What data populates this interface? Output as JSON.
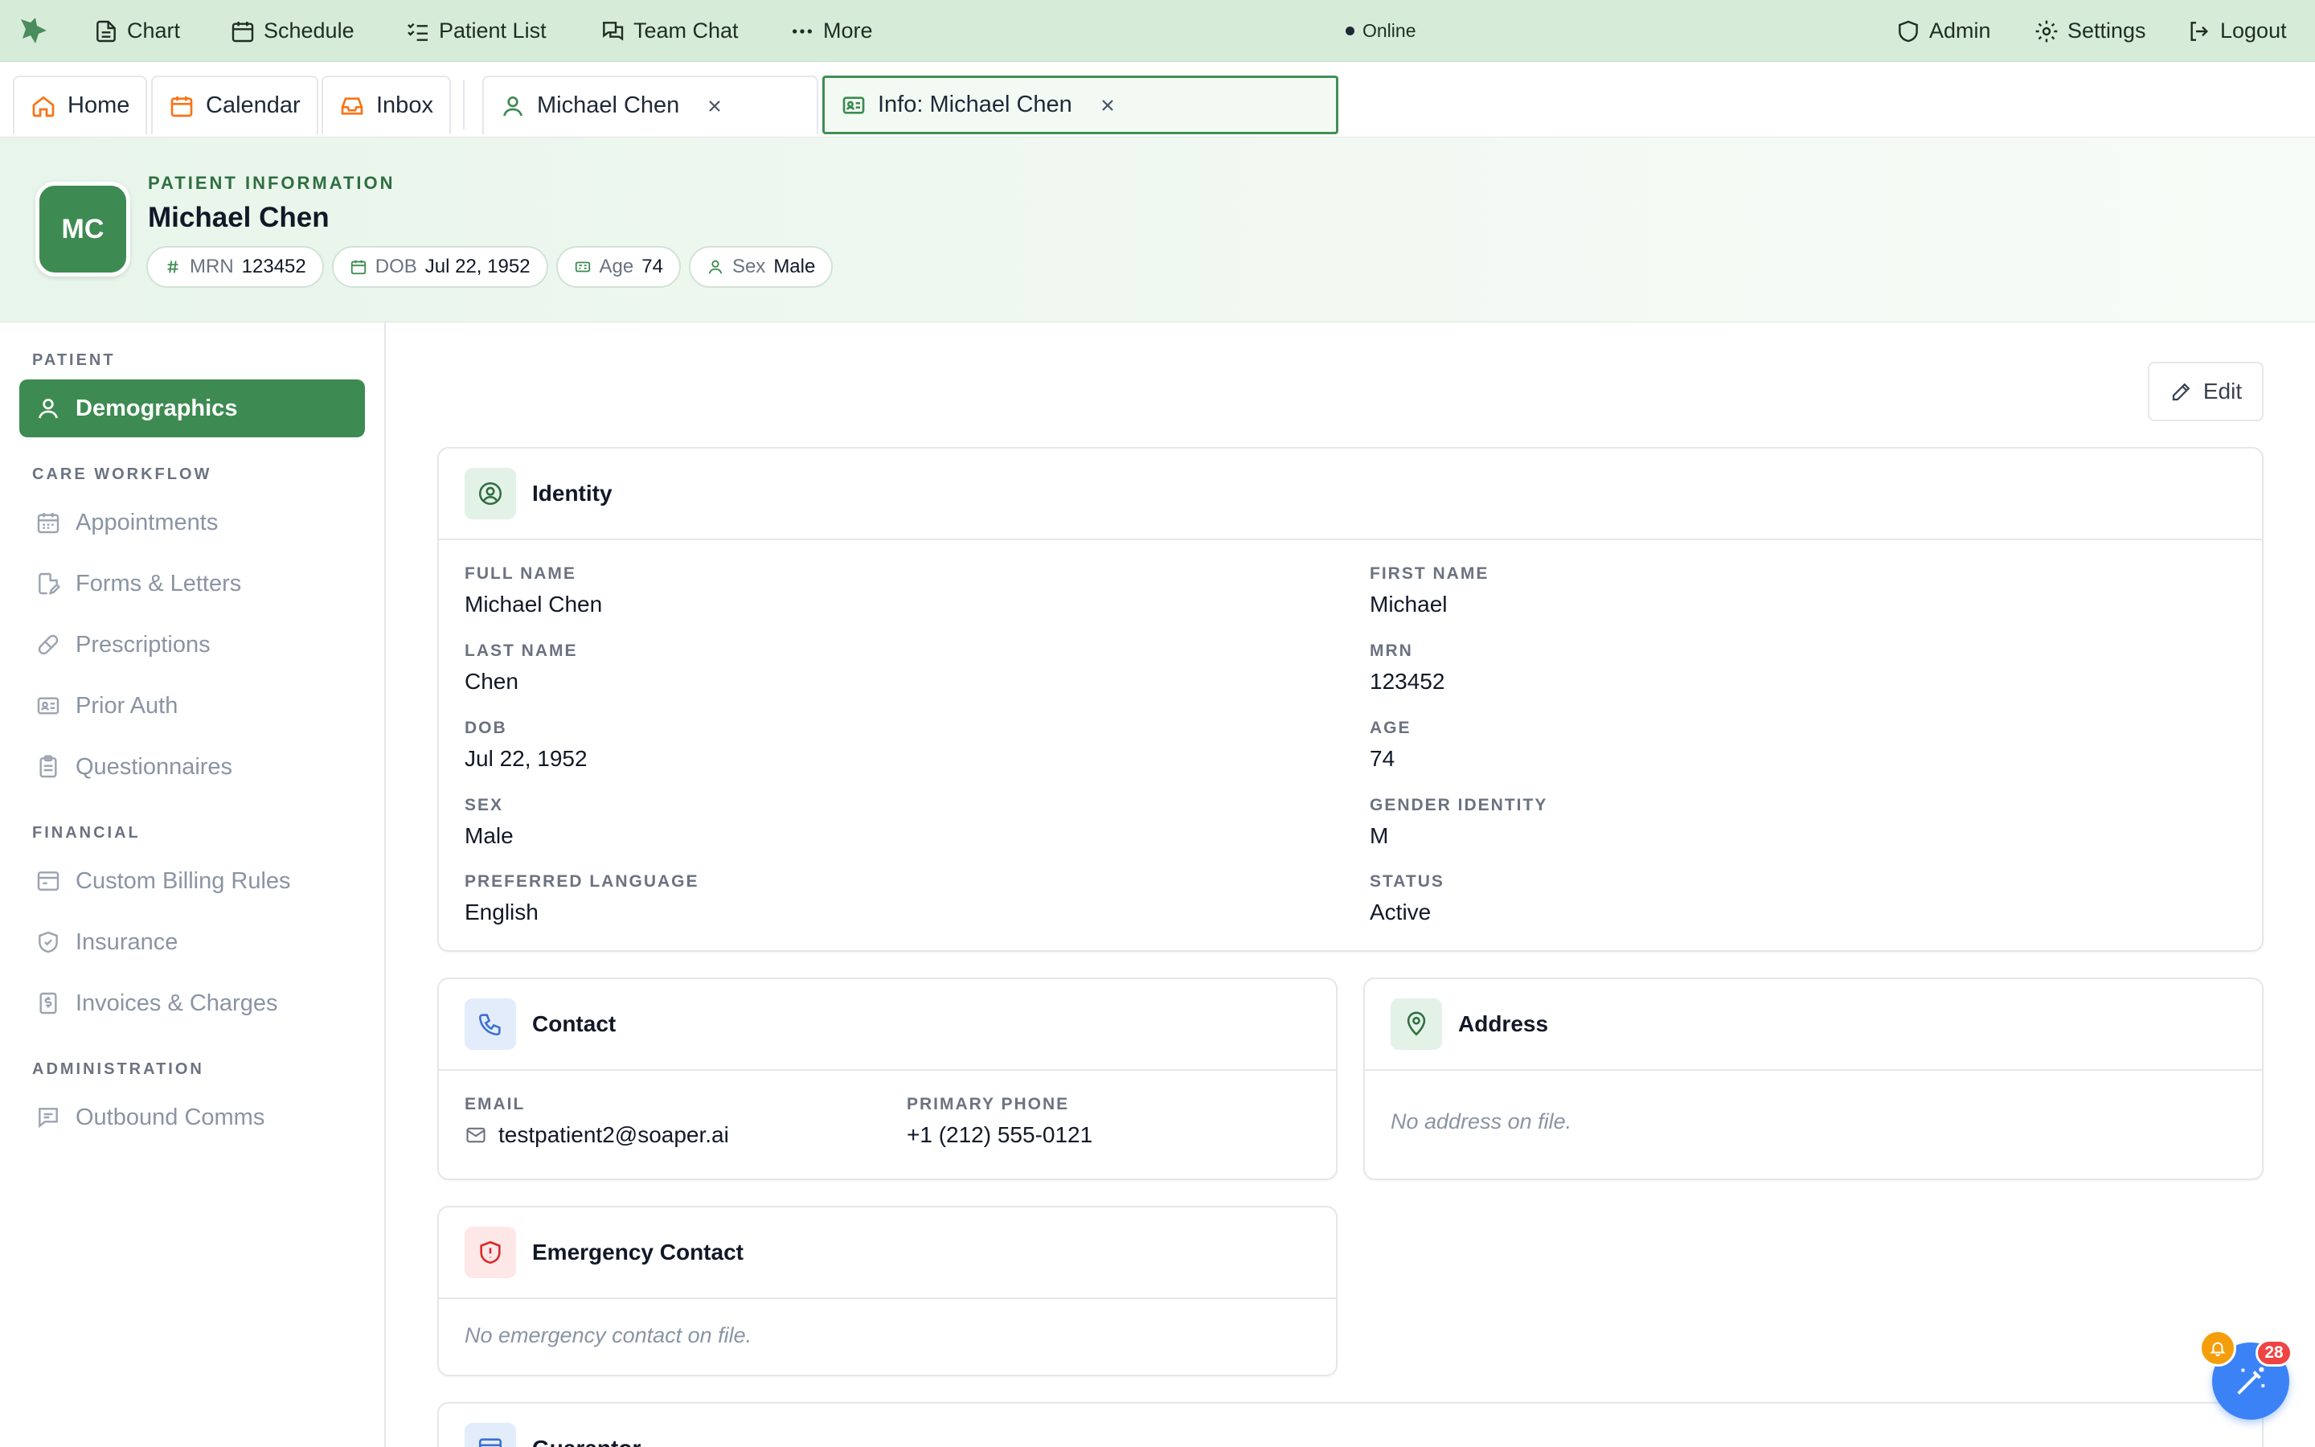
{
  "nav": {
    "items": [
      {
        "label": "Chart",
        "icon": "file-text-icon"
      },
      {
        "label": "Schedule",
        "icon": "calendar-icon"
      },
      {
        "label": "Patient List",
        "icon": "list-checks-icon"
      },
      {
        "label": "Team Chat",
        "icon": "chat-icon"
      },
      {
        "label": "More",
        "icon": "more-dots-icon"
      }
    ],
    "status": "Online",
    "right": [
      {
        "label": "Admin",
        "icon": "shield-icon"
      },
      {
        "label": "Settings",
        "icon": "gear-icon"
      },
      {
        "label": "Logout",
        "icon": "logout-icon"
      }
    ]
  },
  "tabs": {
    "pinned": [
      {
        "label": "Home",
        "icon": "home-icon"
      },
      {
        "label": "Calendar",
        "icon": "calendar-icon"
      },
      {
        "label": "Inbox",
        "icon": "inbox-icon"
      }
    ],
    "open": [
      {
        "label": "Michael Chen",
        "icon": "user-icon",
        "active": false
      },
      {
        "label": "Info: Michael Chen",
        "icon": "id-card-icon",
        "active": true
      }
    ]
  },
  "patient": {
    "eyebrow": "PATIENT INFORMATION",
    "initials": "MC",
    "name": "Michael Chen",
    "chips": [
      {
        "key": "MRN",
        "value": "123452",
        "icon": "hash-icon"
      },
      {
        "key": "DOB",
        "value": "Jul 22, 1952",
        "icon": "calendar-icon"
      },
      {
        "key": "Age",
        "value": "74",
        "icon": "id-card-icon"
      },
      {
        "key": "Sex",
        "value": "Male",
        "icon": "user-icon"
      }
    ]
  },
  "sidebar": {
    "sections": [
      {
        "title": "PATIENT",
        "items": [
          {
            "label": "Demographics",
            "icon": "user-icon",
            "active": true
          }
        ]
      },
      {
        "title": "CARE WORKFLOW",
        "items": [
          {
            "label": "Appointments",
            "icon": "calendar-icon"
          },
          {
            "label": "Forms & Letters",
            "icon": "file-edit-icon"
          },
          {
            "label": "Prescriptions",
            "icon": "pill-icon"
          },
          {
            "label": "Prior Auth",
            "icon": "id-card-icon"
          },
          {
            "label": "Questionnaires",
            "icon": "clipboard-icon"
          }
        ]
      },
      {
        "title": "FINANCIAL",
        "items": [
          {
            "label": "Custom Billing Rules",
            "icon": "wallet-icon"
          },
          {
            "label": "Insurance",
            "icon": "shield-check-icon"
          },
          {
            "label": "Invoices & Charges",
            "icon": "dollar-file-icon"
          }
        ]
      },
      {
        "title": "ADMINISTRATION",
        "items": [
          {
            "label": "Outbound Comms",
            "icon": "message-square-icon"
          }
        ]
      }
    ]
  },
  "main": {
    "edit_label": "Edit",
    "identity": {
      "title": "Identity",
      "fields": [
        {
          "label": "FULL NAME",
          "value": "Michael Chen"
        },
        {
          "label": "FIRST NAME",
          "value": "Michael"
        },
        {
          "label": "LAST NAME",
          "value": "Chen"
        },
        {
          "label": "MRN",
          "value": "123452"
        },
        {
          "label": "DOB",
          "value": "Jul 22, 1952"
        },
        {
          "label": "AGE",
          "value": "74"
        },
        {
          "label": "SEX",
          "value": "Male"
        },
        {
          "label": "GENDER IDENTITY",
          "value": "M"
        },
        {
          "label": "PREFERRED LANGUAGE",
          "value": "English"
        },
        {
          "label": "STATUS",
          "value": "Active"
        }
      ]
    },
    "contact": {
      "title": "Contact",
      "email_label": "EMAIL",
      "email": "testpatient2@soaper.ai",
      "phone_label": "PRIMARY PHONE",
      "phone": "+1 (212) 555-0121"
    },
    "address": {
      "title": "Address",
      "empty": "No address on file."
    },
    "emergency": {
      "title": "Emergency Contact",
      "empty": "No emergency contact on file."
    },
    "guarantor": {
      "title": "Guarantor"
    }
  },
  "fab": {
    "badge": "28"
  },
  "colors": {
    "brand": "#3d8b52",
    "nav_bg": "#d6ecd9",
    "accent_orange": "#f97316",
    "fab_blue": "#3b82f6",
    "badge_red": "#ef4444"
  }
}
